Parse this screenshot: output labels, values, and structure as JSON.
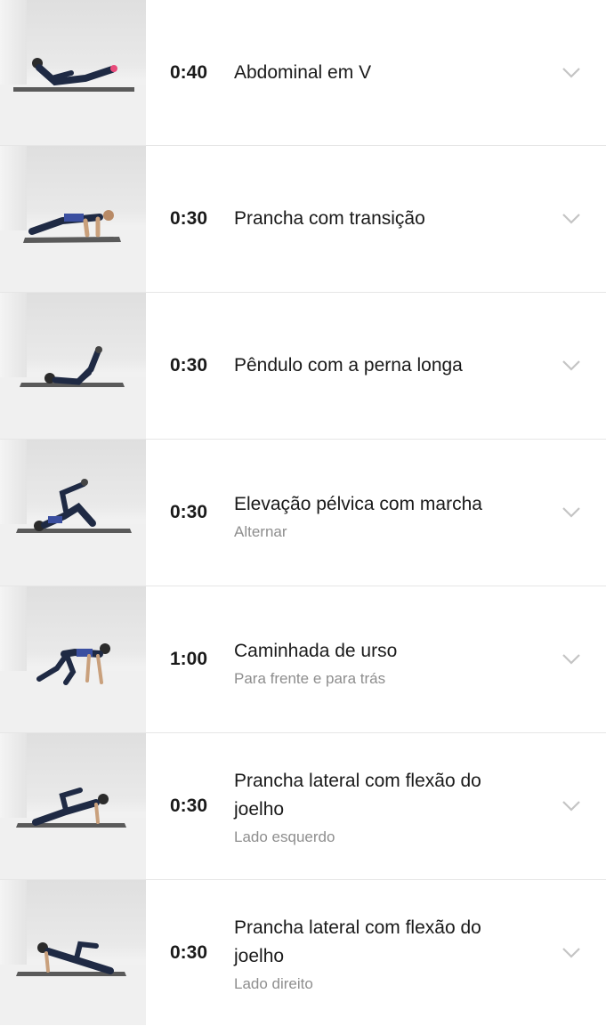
{
  "exercises": [
    {
      "duration": "0:40",
      "title": "Abdominal em V",
      "subtitle": "",
      "icon": "chevron-down-icon"
    },
    {
      "duration": "0:30",
      "title": "Prancha com transição",
      "subtitle": "",
      "icon": "chevron-down-icon"
    },
    {
      "duration": "0:30",
      "title": "Pêndulo com a perna longa",
      "subtitle": "",
      "icon": "chevron-down-icon"
    },
    {
      "duration": "0:30",
      "title": "Elevação pélvica com marcha",
      "subtitle": "Alternar",
      "icon": "chevron-down-icon"
    },
    {
      "duration": "1:00",
      "title": "Caminhada de urso",
      "subtitle": "Para frente e para trás",
      "icon": "chevron-down-icon"
    },
    {
      "duration": "0:30",
      "title": "Prancha lateral com flexão do joelho",
      "subtitle": "Lado esquerdo",
      "icon": "chevron-down-icon"
    },
    {
      "duration": "0:30",
      "title": "Prancha lateral com flexão do joelho",
      "subtitle": "Lado direito",
      "icon": "chevron-down-icon"
    }
  ],
  "colors": {
    "outfit": "#1f2a44",
    "accent": "#3b4fa0",
    "mat": "#5a5a5a",
    "divider": "#e6e6e6"
  }
}
